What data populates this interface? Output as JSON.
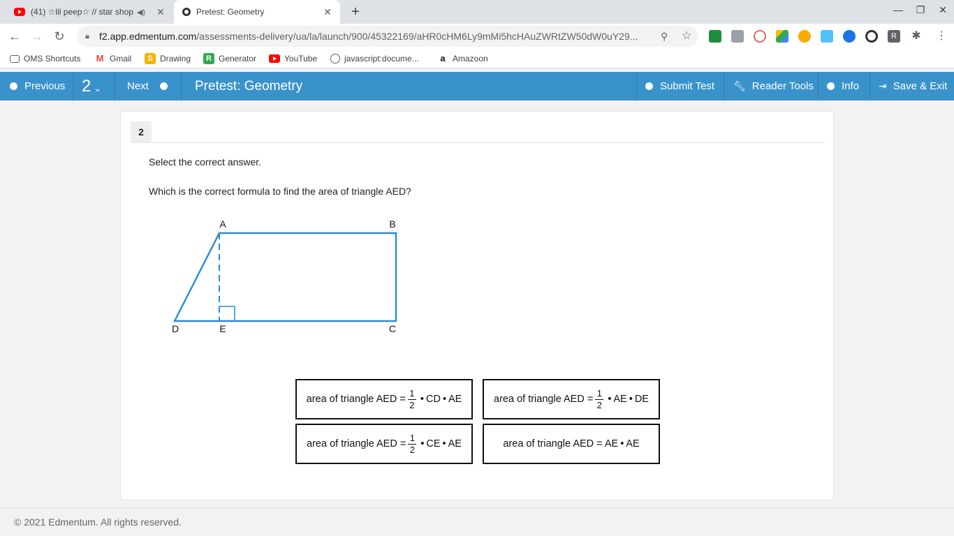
{
  "browser": {
    "tabs": [
      {
        "title": "(41) ☆lil peep☆ // star shop",
        "active": false
      },
      {
        "title": "Pretest: Geometry",
        "active": true
      }
    ],
    "url_host": "f2.app.edmentum.com",
    "url_path": "/assessments-delivery/ua/la/launch/900/45322169/aHR0cHM6Ly9mMi5hcHAuZWRtZW50dW0uY29..."
  },
  "bookmarks": [
    {
      "label": "OMS Shortcuts",
      "icon": "folder-icon"
    },
    {
      "label": "Gmail",
      "icon": "gmail-icon"
    },
    {
      "label": "Drawing",
      "icon": "drawing-icon"
    },
    {
      "label": "Generator",
      "icon": "generator-icon"
    },
    {
      "label": "YouTube",
      "icon": "youtube-icon"
    },
    {
      "label": "javascript:docume...",
      "icon": "globe-icon"
    },
    {
      "label": "Amazoon",
      "icon": "amazon-icon"
    }
  ],
  "appbar": {
    "previous_label": "Previous",
    "question_selector": "2",
    "next_label": "Next",
    "title": "Pretest: Geometry",
    "submit_label": "Submit Test",
    "reader_tools_label": "Reader Tools",
    "info_label": "Info",
    "save_exit_label": "Save & Exit",
    "color": "#3a92ca"
  },
  "question": {
    "number": "2",
    "instruction": "Select the correct answer.",
    "prompt": "Which is the correct formula to find the area of triangle AED?",
    "figure_labels": {
      "A": "A",
      "B": "B",
      "C": "C",
      "D": "D",
      "E": "E"
    },
    "choices": [
      {
        "prefix": "area of triangle AED =",
        "num": "1",
        "den": "2",
        "terms": [
          "CD",
          "AE"
        ]
      },
      {
        "prefix": "area of triangle AED =",
        "num": "1",
        "den": "2",
        "terms": [
          "AE",
          "DE"
        ]
      },
      {
        "prefix": "area of triangle AED =",
        "num": "1",
        "den": "2",
        "terms": [
          "CE",
          "AE"
        ]
      },
      {
        "prefix": "area of triangle AED = AE",
        "num": "",
        "den": "",
        "terms": [
          "AE"
        ]
      }
    ]
  },
  "footer": {
    "copyright": "© 2021 Edmentum. All rights reserved."
  }
}
